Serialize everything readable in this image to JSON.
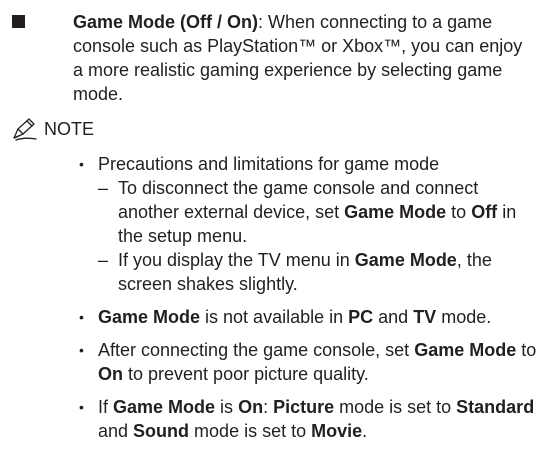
{
  "main": {
    "title": "Game Mode (Off / On)",
    "description": ": When connecting to a game console such as PlayStation™ or Xbox™, you can enjoy a more realistic gaming experience by selecting game mode."
  },
  "note": {
    "icon": "pencil-note-icon",
    "label": "NOTE"
  },
  "items": {
    "precautions": "Precautions and limitations for game mode",
    "sub1": {
      "a": "To disconnect the game console and connect another external device, set ",
      "b": "Game Mode",
      "c": " to ",
      "d": "Off",
      "e": " in the setup menu."
    },
    "sub2": {
      "a": "If you display the TV menu in ",
      "b": "Game Mode",
      "c": ", the screen shakes slightly."
    },
    "item2": {
      "a": "Game Mode",
      "b": " is not available in ",
      "c": "PC",
      "d": " and ",
      "e": "TV",
      "f": " mode."
    },
    "item3": {
      "a": "After connecting the game console, set ",
      "b": "Game Mode",
      "c": " to ",
      "d": "On",
      "e": " to prevent poor picture quality."
    },
    "item4": {
      "a": "If ",
      "b": "Game Mode",
      "c": " is ",
      "d": "On",
      "e": ": ",
      "f": "Picture",
      "g": " mode is set to ",
      "h": "Standard",
      "i": " and ",
      "j": "Sound",
      "k": " mode is set to ",
      "l": "Movie",
      "m": "."
    }
  }
}
